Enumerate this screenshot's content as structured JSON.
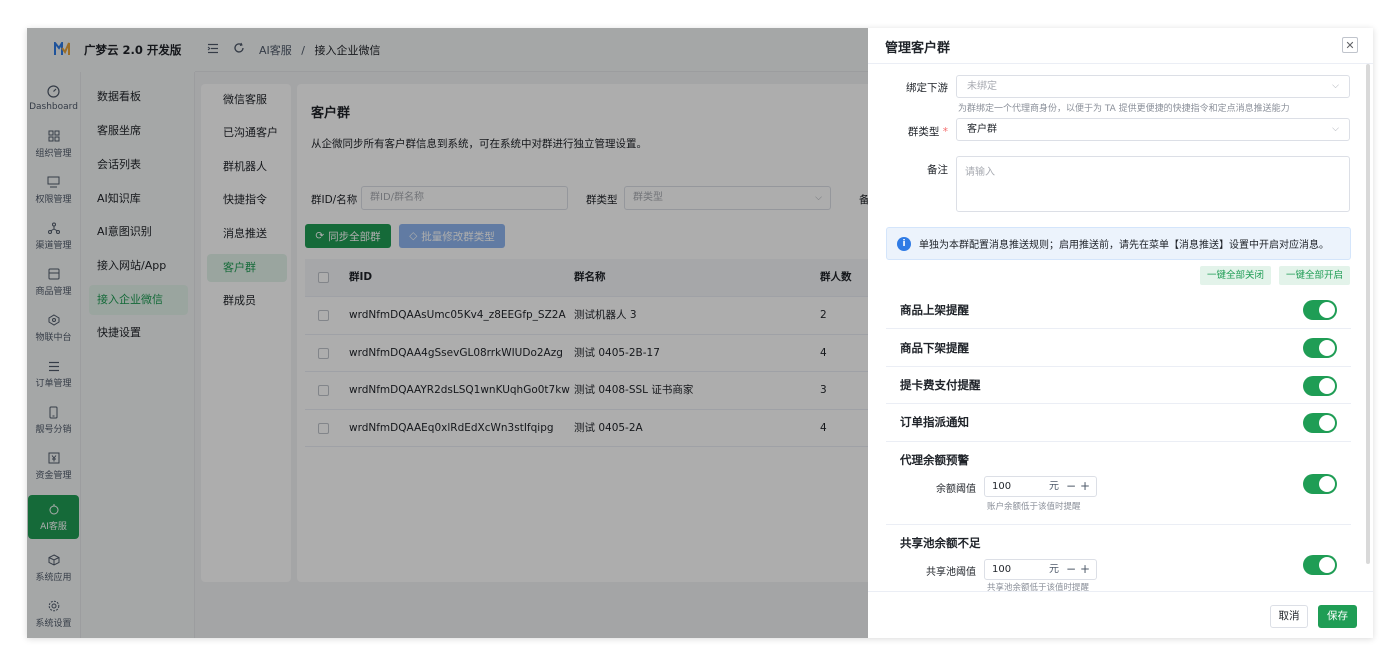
{
  "app": {
    "title": "广梦云 2.0 开发版"
  },
  "header": {
    "breadcrumb_parent": "AI客服",
    "breadcrumb_sep": "/",
    "breadcrumb_current": "接入企业微信"
  },
  "rail": [
    {
      "label": "Dashboard",
      "icon": "dashboard-icon"
    },
    {
      "label": "组织管理",
      "icon": "org-icon"
    },
    {
      "label": "权限管理",
      "icon": "permission-icon"
    },
    {
      "label": "渠道管理",
      "icon": "channel-icon"
    },
    {
      "label": "商品管理",
      "icon": "goods-icon"
    },
    {
      "label": "物联中台",
      "icon": "iot-icon"
    },
    {
      "label": "订单管理",
      "icon": "order-icon"
    },
    {
      "label": "靓号分销",
      "icon": "phone-icon"
    },
    {
      "label": "资金管理",
      "icon": "money-icon"
    },
    {
      "label": "AI客服",
      "icon": "robot-icon"
    },
    {
      "label": "系统应用",
      "icon": "cube-icon"
    },
    {
      "label": "系统设置",
      "icon": "gear-icon"
    }
  ],
  "submenu": [
    "数据看板",
    "客服坐席",
    "会话列表",
    "AI知识库",
    "AI意图识别",
    "接入网站/App",
    "接入企业微信",
    "快捷设置"
  ],
  "thirdmenu": [
    "微信客服",
    "已沟通客户",
    "群机器人",
    "快捷指令",
    "消息推送",
    "客户群",
    "群成员"
  ],
  "main": {
    "title": "客户群",
    "desc": "从企微同步所有客户群信息到系统，可在系统中对群进行独立管理设置。",
    "filter_id_label": "群ID/名称",
    "filter_id_placeholder": "群ID/群名称",
    "filter_type_label": "群类型",
    "filter_type_placeholder": "群类型",
    "filter_more_label": "备",
    "sync_btn": "同步全部群",
    "batch_btn": "批量修改群类型",
    "columns": [
      "群ID",
      "群名称",
      "群人数"
    ],
    "rows": [
      {
        "id": "wrdNfmDQAAsUmc05Kv4_z8EEGfp_SZ2A",
        "name": "测试机器人 3",
        "count": "2"
      },
      {
        "id": "wrdNfmDQAA4gSsevGL08rrkWIUDo2Azg",
        "name": "测试 0405-2B-17",
        "count": "4"
      },
      {
        "id": "wrdNfmDQAAYR2dsLSQ1wnKUqhGo0t7kw",
        "name": "测试 0408-SSL 证书商家",
        "count": "3"
      },
      {
        "id": "wrdNfmDQAAEq0xlRdEdXcWn3stIfqipg",
        "name": "测试 0405-2A",
        "count": "4"
      }
    ]
  },
  "drawer": {
    "title": "管理客户群",
    "bind_label": "绑定下游",
    "bind_value": "未绑定",
    "bind_hint": "为群绑定一个代理商身份，以便于为 TA 提供更便捷的快捷指令和定点消息推送能力",
    "type_label": "群类型",
    "type_required": "*",
    "type_value": "客户群",
    "note_label": "备注",
    "note_placeholder": "请输入",
    "info_text": "单独为本群配置消息推送规则；启用推送前，请先在菜单【消息推送】设置中开启对应消息。",
    "info_icon": "i",
    "close_all": "一键全部关闭",
    "open_all": "一键全部开启",
    "notifications": [
      {
        "title": "商品上架提醒",
        "on": true
      },
      {
        "title": "商品下架提醒",
        "on": true
      },
      {
        "title": "提卡费支付提醒",
        "on": true
      },
      {
        "title": "订单指派通知",
        "on": true
      },
      {
        "title": "代理余额预警",
        "on": true,
        "field_label": "余额阈值",
        "value": "100",
        "unit": "元",
        "hint": "账户余额低于该值时提醒"
      },
      {
        "title": "共享池余额不足",
        "on": true,
        "field_label": "共享池阈值",
        "value": "100",
        "unit": "元",
        "hint": "共享池余额低于该值时提醒"
      }
    ],
    "stepper_minus": "−",
    "stepper_plus": "+",
    "cancel": "取消",
    "save": "保存"
  },
  "colors": {
    "accent": "#1f9d55",
    "info": "#2f7be5",
    "batch": "#8fb6f0"
  }
}
